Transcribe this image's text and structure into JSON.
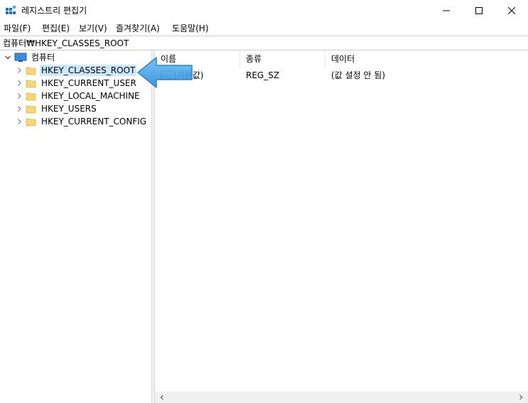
{
  "window": {
    "title": "레지스트리 편집기",
    "icon": "registry-editor-icon",
    "controls": {
      "minimize": "minimize-icon",
      "maximize": "maximize-icon",
      "close": "close-icon"
    }
  },
  "menu": [
    "파일(F)",
    "편집(E)",
    "보기(V)",
    "즐겨찾기(A)",
    "도움말(H)"
  ],
  "address": "컴퓨터₩HKEY_CLASSES_ROOT",
  "tree": {
    "root": "컴퓨터",
    "items": [
      {
        "label": "HKEY_CLASSES_ROOT",
        "selected": true
      },
      {
        "label": "HKEY_CURRENT_USER",
        "selected": false
      },
      {
        "label": "HKEY_LOCAL_MACHINE",
        "selected": false
      },
      {
        "label": "HKEY_USERS",
        "selected": false
      },
      {
        "label": "HKEY_CURRENT_CONFIG",
        "selected": false
      }
    ]
  },
  "list": {
    "columns": [
      "이름",
      "종류",
      "데이터"
    ],
    "rows": [
      {
        "name": "(기본값)",
        "type": "REG_SZ",
        "data": "(값 설정 안 됨)"
      }
    ]
  },
  "colors": {
    "selection": "#cce8ff",
    "arrow": "#3a9ee4",
    "folder": "#f7d774"
  }
}
